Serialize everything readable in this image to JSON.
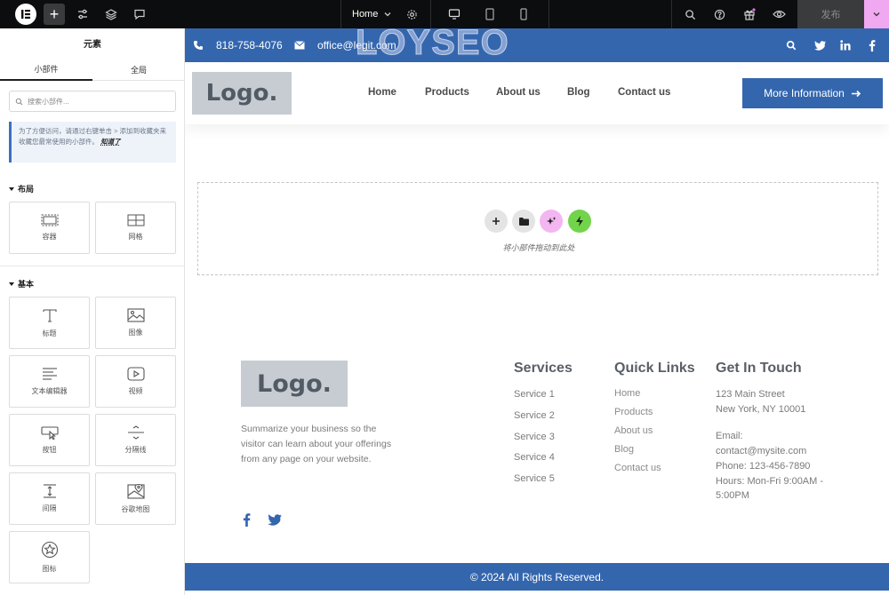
{
  "toolbar": {
    "page_select": "Home",
    "publish_label": "发布"
  },
  "panel": {
    "title": "元素",
    "tabs": [
      "小部件",
      "全局"
    ],
    "search_placeholder": "搜索小部件...",
    "notice_text": "为了方便访问，请通过右键单击 > 添加到收藏夹来收藏您最常使用的小部件。",
    "notice_link": "知道了",
    "section_layout": "布局",
    "section_basic": "基本",
    "layout_widgets": [
      "容器",
      "网格"
    ],
    "basic_widgets": [
      "标题",
      "图像",
      "文本编辑器",
      "视频",
      "按钮",
      "分隔线",
      "间隔",
      "谷歌地图",
      "图标"
    ]
  },
  "site": {
    "phone": "818-758-4076",
    "email": "office@legit.com",
    "watermark": "LOYSEO",
    "logo_text": "Logo.",
    "nav": [
      "Home",
      "Products",
      "About us",
      "Blog",
      "Contact us"
    ],
    "cta_label": "More Information",
    "dropzone_text": "将小部件拖动到此处",
    "footer": {
      "logo_text": "Logo.",
      "description": "Summarize your business so the visitor can learn about your offerings from any page on your website.",
      "services_title": "Services",
      "services": [
        "Service 1",
        "Service 2",
        "Service 3",
        "Service 4",
        "Service 5"
      ],
      "links_title": "Quick Links",
      "links": [
        "Home",
        "Products",
        "About us",
        "Blog",
        "Contact us"
      ],
      "touch_title": "Get In Touch",
      "address1": "123 Main Street",
      "address2": "New York, NY 10001",
      "email_label": "Email:",
      "email": "contact@mysite.com",
      "phone": "Phone: 123-456-7890",
      "hours1": "Hours: Mon-Fri 9:00AM -",
      "hours2": "5:00PM"
    },
    "copyright": "© 2024 All Rights Reserved."
  },
  "colors": {
    "brand_blue": "#3466ae",
    "toolbar_bg": "#0c0d0e",
    "publish_accent": "#f0a8f0",
    "dz_ai": "#f3b6f1",
    "dz_green": "#72d44a"
  }
}
